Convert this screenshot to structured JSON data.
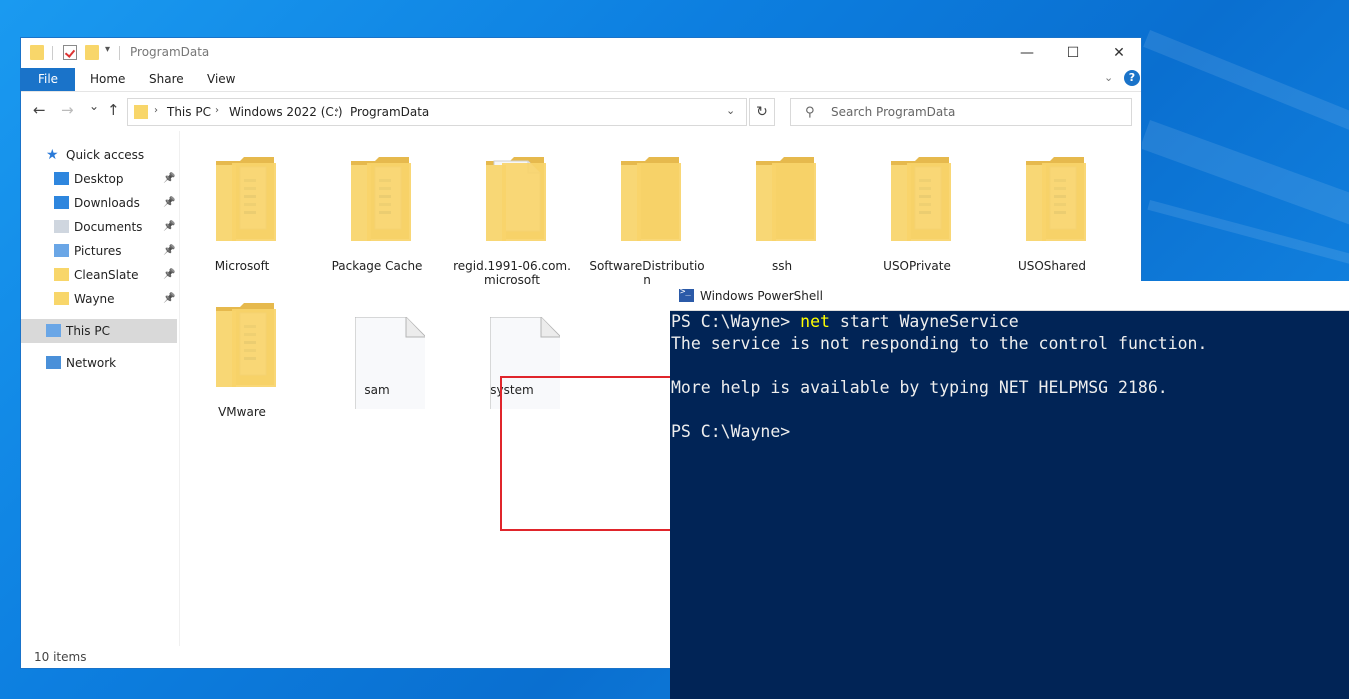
{
  "explorer": {
    "title": "ProgramData",
    "window_buttons": {
      "minimize": "—",
      "maximize": "☐",
      "close": "✕"
    },
    "ribbon": {
      "file": "File",
      "tabs": [
        "Home",
        "Share",
        "View"
      ],
      "help": "?"
    },
    "nav": {
      "back": "←",
      "forward": "→",
      "recent": "⌄",
      "up": "↑"
    },
    "breadcrumb": [
      "This PC",
      "Windows 2022 (C:)",
      "ProgramData"
    ],
    "breadcrumb_sep": "›",
    "search_placeholder": "Search ProgramData",
    "sidebar": [
      {
        "label": "Quick access",
        "icon": "star-icon",
        "pinned": false
      },
      {
        "label": "Desktop",
        "icon": "desktop-icon",
        "pinned": true
      },
      {
        "label": "Downloads",
        "icon": "download-icon",
        "pinned": true
      },
      {
        "label": "Documents",
        "icon": "documents-icon",
        "pinned": true
      },
      {
        "label": "Pictures",
        "icon": "pictures-icon",
        "pinned": true
      },
      {
        "label": "CleanSlate",
        "icon": "folder-icon",
        "pinned": true
      },
      {
        "label": "Wayne",
        "icon": "folder-icon",
        "pinned": true
      },
      {
        "label": "This PC",
        "icon": "computer-icon",
        "pinned": false
      },
      {
        "label": "Network",
        "icon": "network-icon",
        "pinned": false
      }
    ],
    "items": [
      {
        "name": "Microsoft",
        "type": "folder-docs"
      },
      {
        "name": "Package Cache",
        "type": "folder-docs"
      },
      {
        "name": "regid.1991-06.com.\nmicrosoft",
        "type": "folder-page"
      },
      {
        "name": "SoftwareDistributio\nn",
        "type": "folder"
      },
      {
        "name": "ssh",
        "type": "folder"
      },
      {
        "name": "USOPrivate",
        "type": "folder-docs"
      },
      {
        "name": "USOShared",
        "type": "folder-docs"
      },
      {
        "name": "VMware",
        "type": "folder-docs"
      },
      {
        "name": "sam",
        "type": "file"
      },
      {
        "name": "system",
        "type": "file"
      }
    ],
    "status": "10 items"
  },
  "powershell": {
    "title": "Windows PowerShell",
    "prompt1": "PS C:\\Wayne> ",
    "command": "net",
    "command_args": " start WayneService",
    "output1": "The service is not responding to the control function.",
    "output2": "More help is available by typing NET HELPMSG 2186.",
    "prompt2": "PS C:\\Wayne>"
  },
  "colors": {
    "accent": "#1a73c9",
    "highlight_box": "#e0252b",
    "ps_bg": "#012456",
    "ps_command": "#ffff00"
  }
}
